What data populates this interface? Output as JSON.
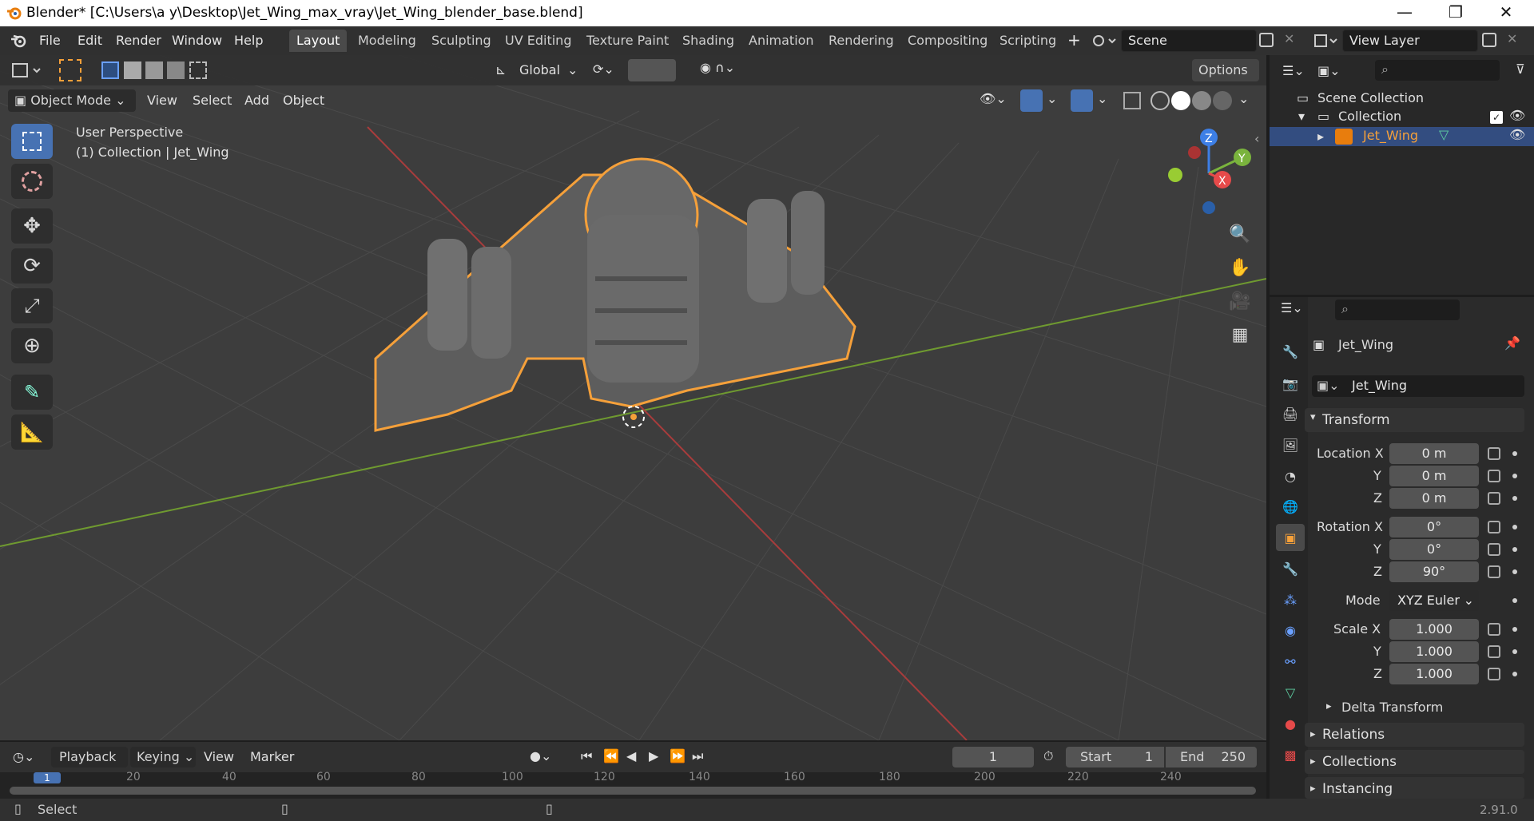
{
  "window": {
    "title": "Blender* [C:\\Users\\a y\\Desktop\\Jet_Wing_max_vray\\Jet_Wing_blender_base.blend]",
    "minimize": "—",
    "maximize": "❐",
    "close": "✕"
  },
  "menu": [
    "File",
    "Edit",
    "Render",
    "Window",
    "Help"
  ],
  "workspaces": [
    "Layout",
    "Modeling",
    "Sculpting",
    "UV Editing",
    "Texture Paint",
    "Shading",
    "Animation",
    "Rendering",
    "Compositing",
    "Scripting"
  ],
  "active_workspace": "Layout",
  "scene": {
    "label": "Scene"
  },
  "view_layer": {
    "label": "View Layer"
  },
  "toolbar_header": {
    "orientation": "Global",
    "options": "Options"
  },
  "viewport_header": {
    "mode": "Object Mode",
    "menus": [
      "View",
      "Select",
      "Add",
      "Object"
    ]
  },
  "viewport_overlay": {
    "perspective": "User Perspective",
    "collection": "(1) Collection | Jet_Wing"
  },
  "gizmo": {
    "x": "X",
    "y": "Y",
    "z": "Z"
  },
  "outliner": {
    "scene_collection": "Scene Collection",
    "collection": "Collection",
    "object": "Jet_Wing"
  },
  "properties": {
    "object_name": "Jet_Wing",
    "data_name": "Jet_Wing",
    "transform_title": "Transform",
    "location_label": "Location X",
    "rotation_label": "Rotation X",
    "scale_label": "Scale X",
    "y": "Y",
    "z": "Z",
    "location": [
      "0 m",
      "0 m",
      "0 m"
    ],
    "rotation": [
      "0°",
      "0°",
      "90°"
    ],
    "mode_label": "Mode",
    "mode": "XYZ Euler",
    "scale": [
      "1.000",
      "1.000",
      "1.000"
    ],
    "delta": "Delta Transform",
    "relations": "Relations",
    "collections": "Collections",
    "instancing": "Instancing"
  },
  "timeline": {
    "menus": [
      "Playback",
      "Keying",
      "View",
      "Marker"
    ],
    "current_frame": "1",
    "start_label": "Start",
    "start": "1",
    "end_label": "End",
    "end": "250",
    "ticks": [
      "1",
      "20",
      "40",
      "60",
      "80",
      "100",
      "120",
      "140",
      "160",
      "180",
      "200",
      "220",
      "240"
    ]
  },
  "status": {
    "select": "Select",
    "version": "2.91.0"
  },
  "colors": {
    "accent": "#4772b3",
    "selection_outline": "#f5a03a",
    "x_axis": "#e64a4a",
    "y_axis": "#7ab33d",
    "z_axis": "#3d7fe6"
  }
}
